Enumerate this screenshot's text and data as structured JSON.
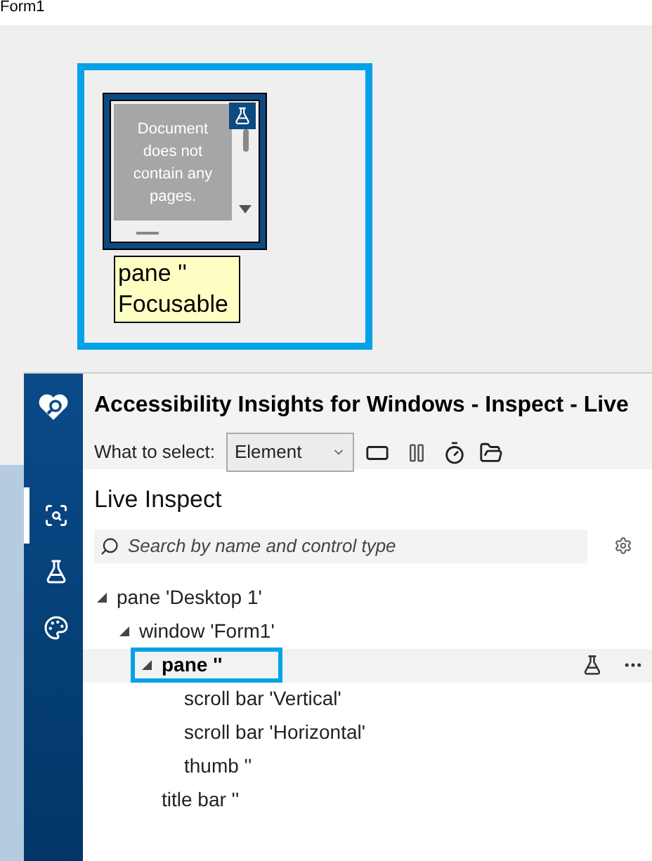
{
  "form_window": {
    "title": "Form1"
  },
  "preview": {
    "text": "Document does not contain any pages."
  },
  "tooltip": {
    "lines": [
      "pane ''",
      "Focusable"
    ]
  },
  "inspector": {
    "title": "Accessibility Insights for Windows - Inspect - Live",
    "select_label": "What to select:",
    "select_value": "Element",
    "section_title": "Live Inspect",
    "search": {
      "placeholder": "Search by name and control type"
    },
    "nav": [
      {
        "kind": "inspect",
        "selected": true
      },
      {
        "kind": "test",
        "selected": false
      },
      {
        "kind": "theme",
        "selected": false
      }
    ],
    "tree": [
      {
        "label": "pane 'Desktop 1'",
        "expanded": true,
        "selected": false,
        "children": [
          {
            "label": "window 'Form1'",
            "expanded": true,
            "selected": false,
            "children": [
              {
                "label": "pane ''",
                "expanded": true,
                "selected": true,
                "children": [
                  {
                    "label": "scroll bar 'Vertical'",
                    "selected": false
                  },
                  {
                    "label": "scroll bar 'Horizontal'",
                    "selected": false
                  },
                  {
                    "label": "thumb ''",
                    "selected": false
                  }
                ]
              },
              {
                "label": "title bar ''",
                "selected": false
              }
            ]
          }
        ]
      }
    ]
  }
}
